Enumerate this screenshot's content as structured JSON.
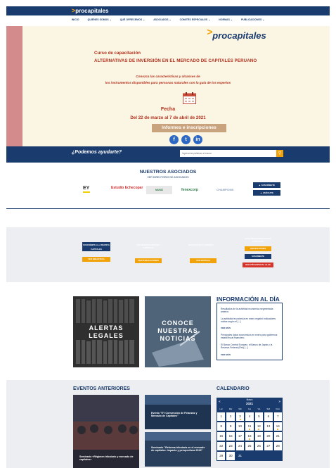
{
  "header": {
    "logo_chevron": ">",
    "logo_text": "procapitales",
    "nav": [
      "INICIO",
      "QUIÉNES SOMOS ⌄",
      "QUÉ OFRECEMOS ⌄",
      "ASOCIADOS ⌄",
      "COMITÉS ESPECIALES ⌄",
      "NORMAS ⌄",
      "PUBLICACIONES ⌄"
    ]
  },
  "hero": {
    "logo_chevron": ">",
    "logo_text": "procapitales",
    "line1": "Curso de capacitación",
    "line2": "ALTERNATIVAS DE INVERSIÓN EN EL MERCADO DE CAPITALES PERUANO",
    "sub1": "Conozca las características y alcances de",
    "sub2": "los instrumentos disponibles para personas naturales con la guía de los expertos",
    "fecha_label": "Fecha",
    "dates": "Del 22 de marzo al 7 de abril de 2021",
    "cta": "Informes e inscripciones",
    "socials": [
      "f",
      "t",
      "in"
    ]
  },
  "help": {
    "text": "¿Podemos ayudarte?",
    "placeholder": "Ingresa las palabras a buscar"
  },
  "asociados": {
    "title": "NUESTROS ASOCIADOS",
    "sub": "VER DIRECTORIO DE ASOCIADOS",
    "logos": [
      "EY",
      "Estudio Echecopar",
      "MUNIZ",
      "fenexcorp",
      "CHAMPIONS"
    ],
    "btn_suscribete": "▲ SUSCRÍBETE",
    "btn_asociate": "▲ ASÓCIATE"
  },
  "links": {
    "dark_left": "SUSCRÍBETE A LA REVISTA CAPITALES",
    "orange_left": "VER BIBLIOTECA",
    "label_mid1": "VER NUESTRA REVISTA CAPITALES",
    "orange_mid1": "VER PUBLICACIONES",
    "label_mid2": "NOTICIAS DE LA SEMANA",
    "orange_mid2": "VER NOTICIAS",
    "label_right": "BOLETÍN INFORMATIVO DE CAPITALES",
    "orange_right1": "VER BOLETINES",
    "orange_right2": "SUSCRÍBETE",
    "red_right": "BOLETÍN ESPECIAL ALAD"
  },
  "tiles": {
    "alertas_1": "ALERTAS",
    "alertas_2": "LEGALES",
    "noticias_1": "CONOCE",
    "noticias_2": "NUESTRAS",
    "noticias_3": "NOTICIAS"
  },
  "info": {
    "title": "INFORMACIÓN AL DÍA",
    "items": [
      "Resultados de la actividad económica segmentada anterior.",
      "La actividad económica en enero registró indicadores mixtas según el [...]",
      "Principales datos económicos en enero para gobiernos estatal fiscal financiero.",
      "El Banco Central Europeo, el Banco de Japón y la Reserva Federal (Fed) [...]"
    ],
    "more": "VER MÁS"
  },
  "events": {
    "title": "EVENTOS ANTERIORES",
    "big_caption": "Seminario «Régimen tributario y mercado de capitales»",
    "small1_caption": "Evento \"EY Convención de Finanzas y Mercado de Capitales\"",
    "small2_caption": "Seminario \"Reforma tributaria en el mercado de capitales: impacto y perspectivas 2019\""
  },
  "calendar": {
    "title": "CALENDARIO",
    "month": "Marzo",
    "year": "2021",
    "prev": "«",
    "next": "»",
    "dows": [
      "Lun",
      "Mar",
      "Mié",
      "Jue",
      "Vie",
      "Sáb",
      "Dom"
    ],
    "days": [
      "1",
      "2",
      "3",
      "4",
      "5",
      "6",
      "7",
      "8",
      "9",
      "10",
      "11",
      "12",
      "13",
      "14",
      "15",
      "16",
      "17",
      "18",
      "19",
      "20",
      "21",
      "22",
      "23",
      "24",
      "25",
      "26",
      "27",
      "28",
      "29",
      "30",
      "31"
    ]
  },
  "colors": {
    "navy": "#1a3b6e",
    "orange": "#f0a30a",
    "hero_red": "#b3311c",
    "hero_bg": "#fbf5e4"
  }
}
